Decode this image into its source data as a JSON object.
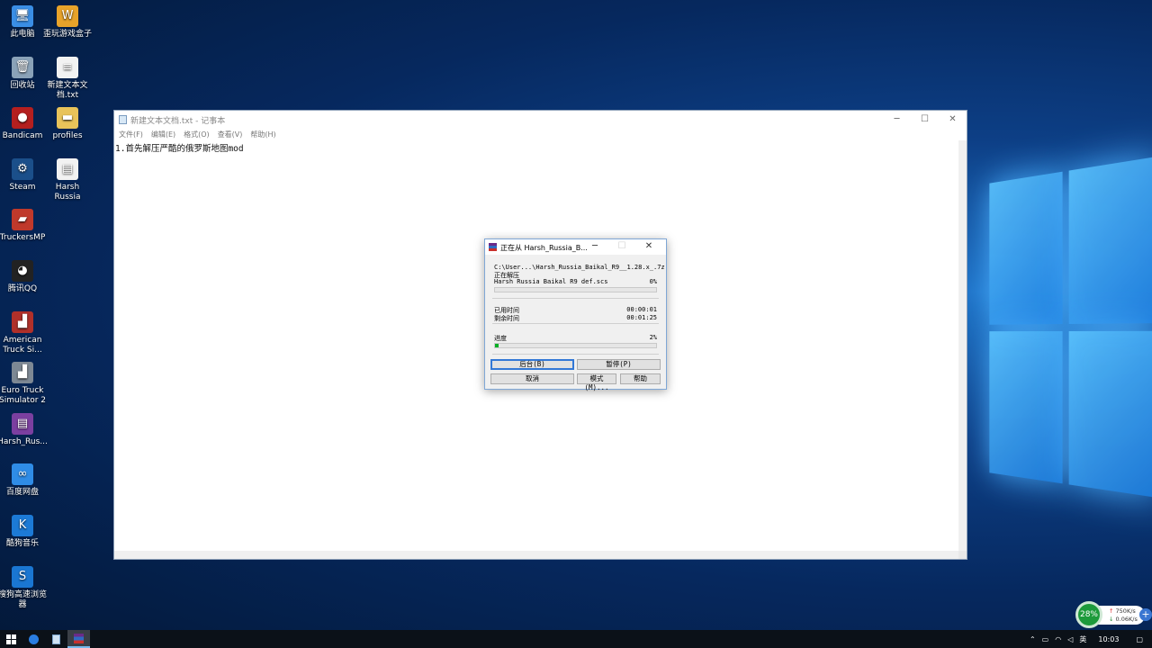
{
  "desktop": {
    "icons": [
      {
        "label": "此电脑",
        "glyph": "🖥",
        "color": "#3a8ee6"
      },
      {
        "label": "歪玩游戏盒子",
        "glyph": "W",
        "color": "#e8a32a"
      },
      {
        "label": "回收站",
        "glyph": "🗑",
        "color": "#8aa2b8"
      },
      {
        "label": "新建文本文档.txt",
        "glyph": "≡",
        "color": "#f2f2f2"
      },
      {
        "label": "Bandicam",
        "glyph": "●",
        "color": "#b41f1f"
      },
      {
        "label": "profiles",
        "glyph": "▬",
        "color": "#e8c35a"
      },
      {
        "label": "Steam",
        "glyph": "⚙",
        "color": "#1b4f8a"
      },
      {
        "label": "Harsh Russia",
        "glyph": "▤",
        "color": "#f2f2f2"
      },
      {
        "label": "TruckersMP",
        "glyph": "▰",
        "color": "#c0392b"
      },
      {
        "label": "腾讯QQ",
        "glyph": "◕",
        "color": "#222222"
      },
      {
        "label": "American Truck Si...",
        "glyph": "▟",
        "color": "#b0302a"
      },
      {
        "label": "Euro Truck Simulator 2",
        "glyph": "▟",
        "color": "#7d8894"
      },
      {
        "label": "Harsh_Rus...",
        "glyph": "▤",
        "color": "#7b3fa0"
      },
      {
        "label": "百度网盘",
        "glyph": "∞",
        "color": "#2f8ce6"
      },
      {
        "label": "酷狗音乐",
        "glyph": "K",
        "color": "#1c7ad6"
      },
      {
        "label": "搜狗高速浏览器",
        "glyph": "S",
        "color": "#1a76d2"
      }
    ]
  },
  "notepad": {
    "title": "新建文本文档.txt - 记事本",
    "menu": [
      "文件(F)",
      "编辑(E)",
      "格式(O)",
      "查看(V)",
      "帮助(H)"
    ],
    "content": "1.首先解压严酷的俄罗斯地图mod"
  },
  "rar_dialog": {
    "title": "正在从 Harsh_Russia_B...",
    "archive_path": "C:\\User...\\Harsh_Russia_Baikal_R9__1.28.x_.7z",
    "status": "正在解压",
    "current_file": "Harsh Russia Baikal R9 def.scs",
    "file_percent": "0%",
    "file_progress": 0.0,
    "elapsed_label": "已用时间",
    "elapsed_value": "00:00:01",
    "remaining_label": "剩余时间",
    "remaining_value": "00:01:25",
    "progress_label": "进度",
    "progress_percent": "2%",
    "progress": 0.02,
    "buttons": {
      "background": "后台(B)",
      "pause": "暂停(P)",
      "cancel": "取消",
      "mode": "模式(M)...",
      "help": "帮助"
    }
  },
  "network_widget": {
    "percent": "28%",
    "upload": "750K/s",
    "download": "0.06K/s"
  },
  "taskbar": {
    "ime": "英",
    "time": "10:03"
  }
}
